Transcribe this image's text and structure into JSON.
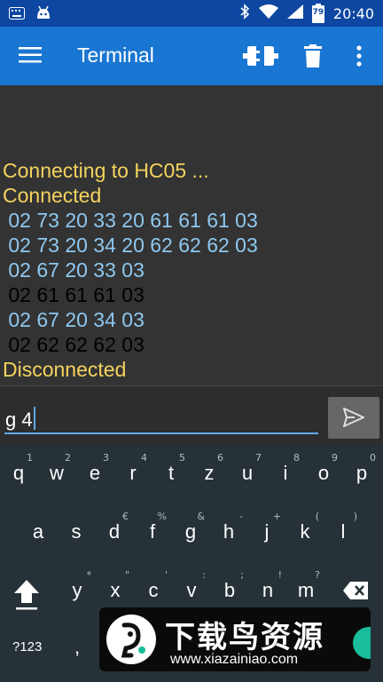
{
  "status_bar": {
    "time": "20:40",
    "battery": "79",
    "icons": [
      "keyboard-icon",
      "android-icon",
      "bluetooth-icon",
      "wifi-icon",
      "signal-icon",
      "battery-icon"
    ]
  },
  "app_bar": {
    "title": "Terminal",
    "icons": [
      "menu-icon",
      "connect-icon",
      "delete-icon",
      "overflow-menu-icon"
    ],
    "color": "#1976d2"
  },
  "terminal": {
    "lines": [
      {
        "text": "Connecting to HC05 ...",
        "kind": "status"
      },
      {
        "text": "Connected",
        "kind": "status"
      },
      {
        "text": " 02 73 20 33 20 61 61 61 03",
        "kind": "sent"
      },
      {
        "text": " 02 73 20 34 20 62 62 62 03",
        "kind": "sent"
      },
      {
        "text": " 02 67 20 33 03",
        "kind": "sent"
      },
      {
        "text": " 02 61 61 61 03",
        "kind": "received"
      },
      {
        "text": " 02 67 20 34 03",
        "kind": "sent"
      },
      {
        "text": " 02 62 62 62 03",
        "kind": "received"
      },
      {
        "text": "Disconnected",
        "kind": "status"
      }
    ],
    "colors": {
      "status": "#f4d35e",
      "sent": "#8ec8f0",
      "received": "#22e322"
    }
  },
  "input": {
    "value": "g 4",
    "send_icon": "send-icon"
  },
  "keyboard": {
    "row1": [
      {
        "key": "q",
        "hint": "1"
      },
      {
        "key": "w",
        "hint": "2"
      },
      {
        "key": "e",
        "hint": "3"
      },
      {
        "key": "r",
        "hint": "4"
      },
      {
        "key": "t",
        "hint": "5"
      },
      {
        "key": "z",
        "hint": "6"
      },
      {
        "key": "u",
        "hint": "7"
      },
      {
        "key": "i",
        "hint": "8"
      },
      {
        "key": "o",
        "hint": "9"
      },
      {
        "key": "p",
        "hint": "0"
      }
    ],
    "row2": [
      {
        "key": "a",
        "hint": ""
      },
      {
        "key": "s",
        "hint": ""
      },
      {
        "key": "d",
        "hint": "€"
      },
      {
        "key": "f",
        "hint": "%"
      },
      {
        "key": "g",
        "hint": "&"
      },
      {
        "key": "h",
        "hint": "-"
      },
      {
        "key": "j",
        "hint": "+"
      },
      {
        "key": "k",
        "hint": "("
      },
      {
        "key": "l",
        "hint": ")"
      }
    ],
    "row3": [
      {
        "key": "y",
        "hint": "*"
      },
      {
        "key": "x",
        "hint": "\""
      },
      {
        "key": "c",
        "hint": "'"
      },
      {
        "key": "v",
        "hint": ":"
      },
      {
        "key": "b",
        "hint": ";"
      },
      {
        "key": "n",
        "hint": "!"
      },
      {
        "key": "m",
        "hint": "?"
      }
    ],
    "row4": {
      "symbols_label": "?123",
      "comma": ","
    },
    "icons": [
      "shift-icon",
      "backspace-icon"
    ]
  },
  "watermark": {
    "title": "下载鸟资源",
    "url": "www.xiazainiao.com"
  }
}
